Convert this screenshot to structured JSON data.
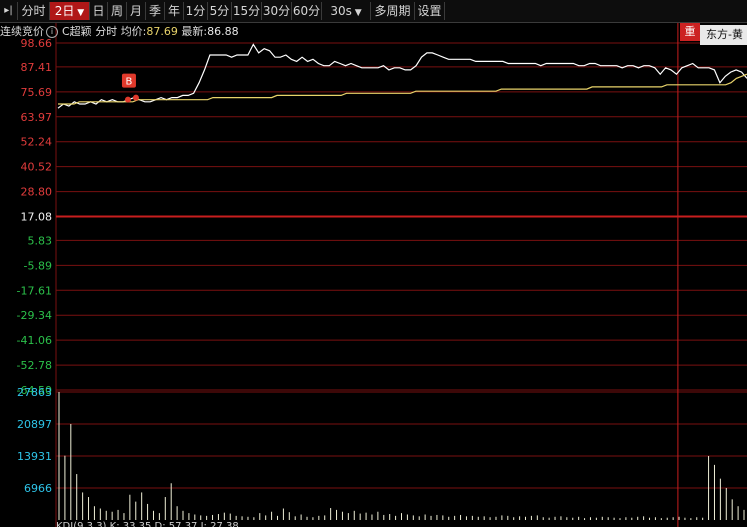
{
  "toolbar": {
    "collapse_icon": "collapse-left-icon",
    "tabs": [
      "分时",
      "2日",
      "日",
      "周",
      "月",
      "季",
      "年",
      "1分",
      "5分",
      "15分",
      "30分",
      "60分",
      "30s",
      "多周期",
      "设置"
    ],
    "active_tab": "2日"
  },
  "header": {
    "auction_label": "连续竞价",
    "stock_name": "C超颖",
    "mode_label": "分时",
    "avg_label": "均价:",
    "avg_value": "87.69",
    "last_label": "最新:",
    "last_value": "86.88"
  },
  "right_badge": {
    "red_label": "重",
    "stock_label": "东方-黄"
  },
  "marker": {
    "label": "B",
    "color": "#e0392b"
  },
  "price_axis": [
    "98.66",
    "87.41",
    "75.69",
    "63.97",
    "52.24",
    "40.52",
    "28.80",
    "17.08",
    "5.83",
    "-5.89",
    "-17.61",
    "-29.34",
    "-41.06",
    "-52.78",
    "-64.50"
  ],
  "volume_axis": [
    "27863",
    "20897",
    "13931",
    "6966"
  ],
  "bottom_legend": "KDJ(9,3,3) K: 33.35 D: 57.37 J: 27.38",
  "colors": {
    "background": "#000000",
    "grid": "#7a1010",
    "base_line": "#c81e1e",
    "price_line": "#ffffff",
    "avg_line": "#e8d36a",
    "up_axis": "#e23c3c",
    "down_axis": "#2bc04a",
    "volume_axis": "#2ec4e8",
    "volume_bars": "#f0f0d8"
  },
  "chart_data": {
    "type": "line",
    "base_price": 17.08,
    "ylim": [
      -64.5,
      98.66
    ],
    "day_split_fraction": 0.9,
    "series": [
      {
        "values": [
          68,
          70,
          69,
          71,
          70,
          70,
          71,
          70,
          72,
          71,
          72,
          71,
          71,
          72,
          73,
          72,
          71,
          71,
          72,
          73,
          72,
          73,
          73,
          74,
          74,
          75,
          80,
          86,
          93,
          93,
          93,
          93,
          92,
          93,
          93,
          93,
          98,
          94,
          96,
          95,
          92,
          92,
          93,
          91,
          90,
          92,
          90,
          91,
          89,
          88,
          88,
          90,
          89,
          88,
          89,
          88,
          87,
          87,
          87,
          87,
          88,
          86,
          87,
          87,
          86,
          86,
          88,
          92,
          94,
          94,
          93,
          92,
          91,
          91,
          91,
          91,
          91,
          90,
          90,
          90,
          90,
          90,
          90,
          89,
          89,
          89,
          89,
          89,
          89,
          88,
          89,
          89,
          89,
          89,
          89,
          89,
          88,
          88,
          89,
          89,
          88,
          88,
          88,
          88,
          87,
          88,
          88,
          87,
          88,
          88,
          87,
          84,
          87,
          86,
          84,
          87,
          88,
          89,
          87,
          87,
          87,
          86,
          80,
          83,
          85,
          86,
          85,
          82
        ]
      },
      {
        "values": [
          70,
          70,
          70,
          70,
          71,
          71,
          71,
          71,
          71,
          71,
          71,
          71,
          71,
          71,
          71,
          72,
          72,
          72,
          72,
          72,
          72,
          72,
          72,
          72,
          72,
          72,
          72,
          72,
          72,
          73,
          73,
          73,
          73,
          73,
          73,
          73,
          73,
          73,
          73,
          73,
          73,
          74,
          74,
          74,
          74,
          74,
          74,
          74,
          74,
          74,
          74,
          74,
          74,
          74,
          75,
          75,
          75,
          75,
          75,
          75,
          75,
          75,
          75,
          75,
          75,
          75,
          75,
          76,
          76,
          76,
          76,
          76,
          76,
          76,
          76,
          76,
          76,
          76,
          76,
          76,
          76,
          76,
          76,
          77,
          77,
          77,
          77,
          77,
          77,
          77,
          77,
          77,
          77,
          77,
          77,
          77,
          77,
          77,
          77,
          77,
          78,
          78,
          78,
          78,
          78,
          78,
          78,
          78,
          78,
          78,
          78,
          78,
          78,
          78,
          79,
          79,
          79,
          79,
          79,
          79,
          79,
          79,
          79,
          79,
          79,
          79,
          80,
          82,
          83,
          84
        ]
      }
    ],
    "volume": [
      27863,
      14000,
      20897,
      10000,
      6000,
      5000,
      3000,
      2500,
      2000,
      1800,
      2200,
      1500,
      5500,
      4000,
      6000,
      3500,
      2000,
      1500,
      5000,
      8000,
      3000,
      2000,
      1500,
      1200,
      1000,
      900,
      1100,
      1300,
      1600,
      1400,
      900,
      800,
      700,
      600,
      1500,
      1000,
      1800,
      900,
      2500,
      1700,
      800,
      1200,
      700,
      600,
      900,
      1000,
      2600,
      2200,
      1800,
      1500,
      2000,
      1400,
      1600,
      1200,
      1800,
      1100,
      1300,
      900,
      1500,
      1200,
      1000,
      800,
      1200,
      900,
      1100,
      1000,
      700,
      900,
      1100,
      800,
      900,
      700,
      800,
      600,
      700,
      1000,
      900,
      600,
      800,
      700,
      900,
      1000,
      600,
      500,
      700,
      800,
      600,
      500,
      700,
      400,
      600,
      500,
      700,
      600,
      500,
      400,
      600,
      500,
      700,
      800,
      500,
      600,
      400,
      500,
      600,
      700,
      500,
      400,
      600,
      500,
      13931,
      12000,
      9000,
      6966,
      4500,
      3000,
      2200
    ],
    "marker_index": 14
  }
}
